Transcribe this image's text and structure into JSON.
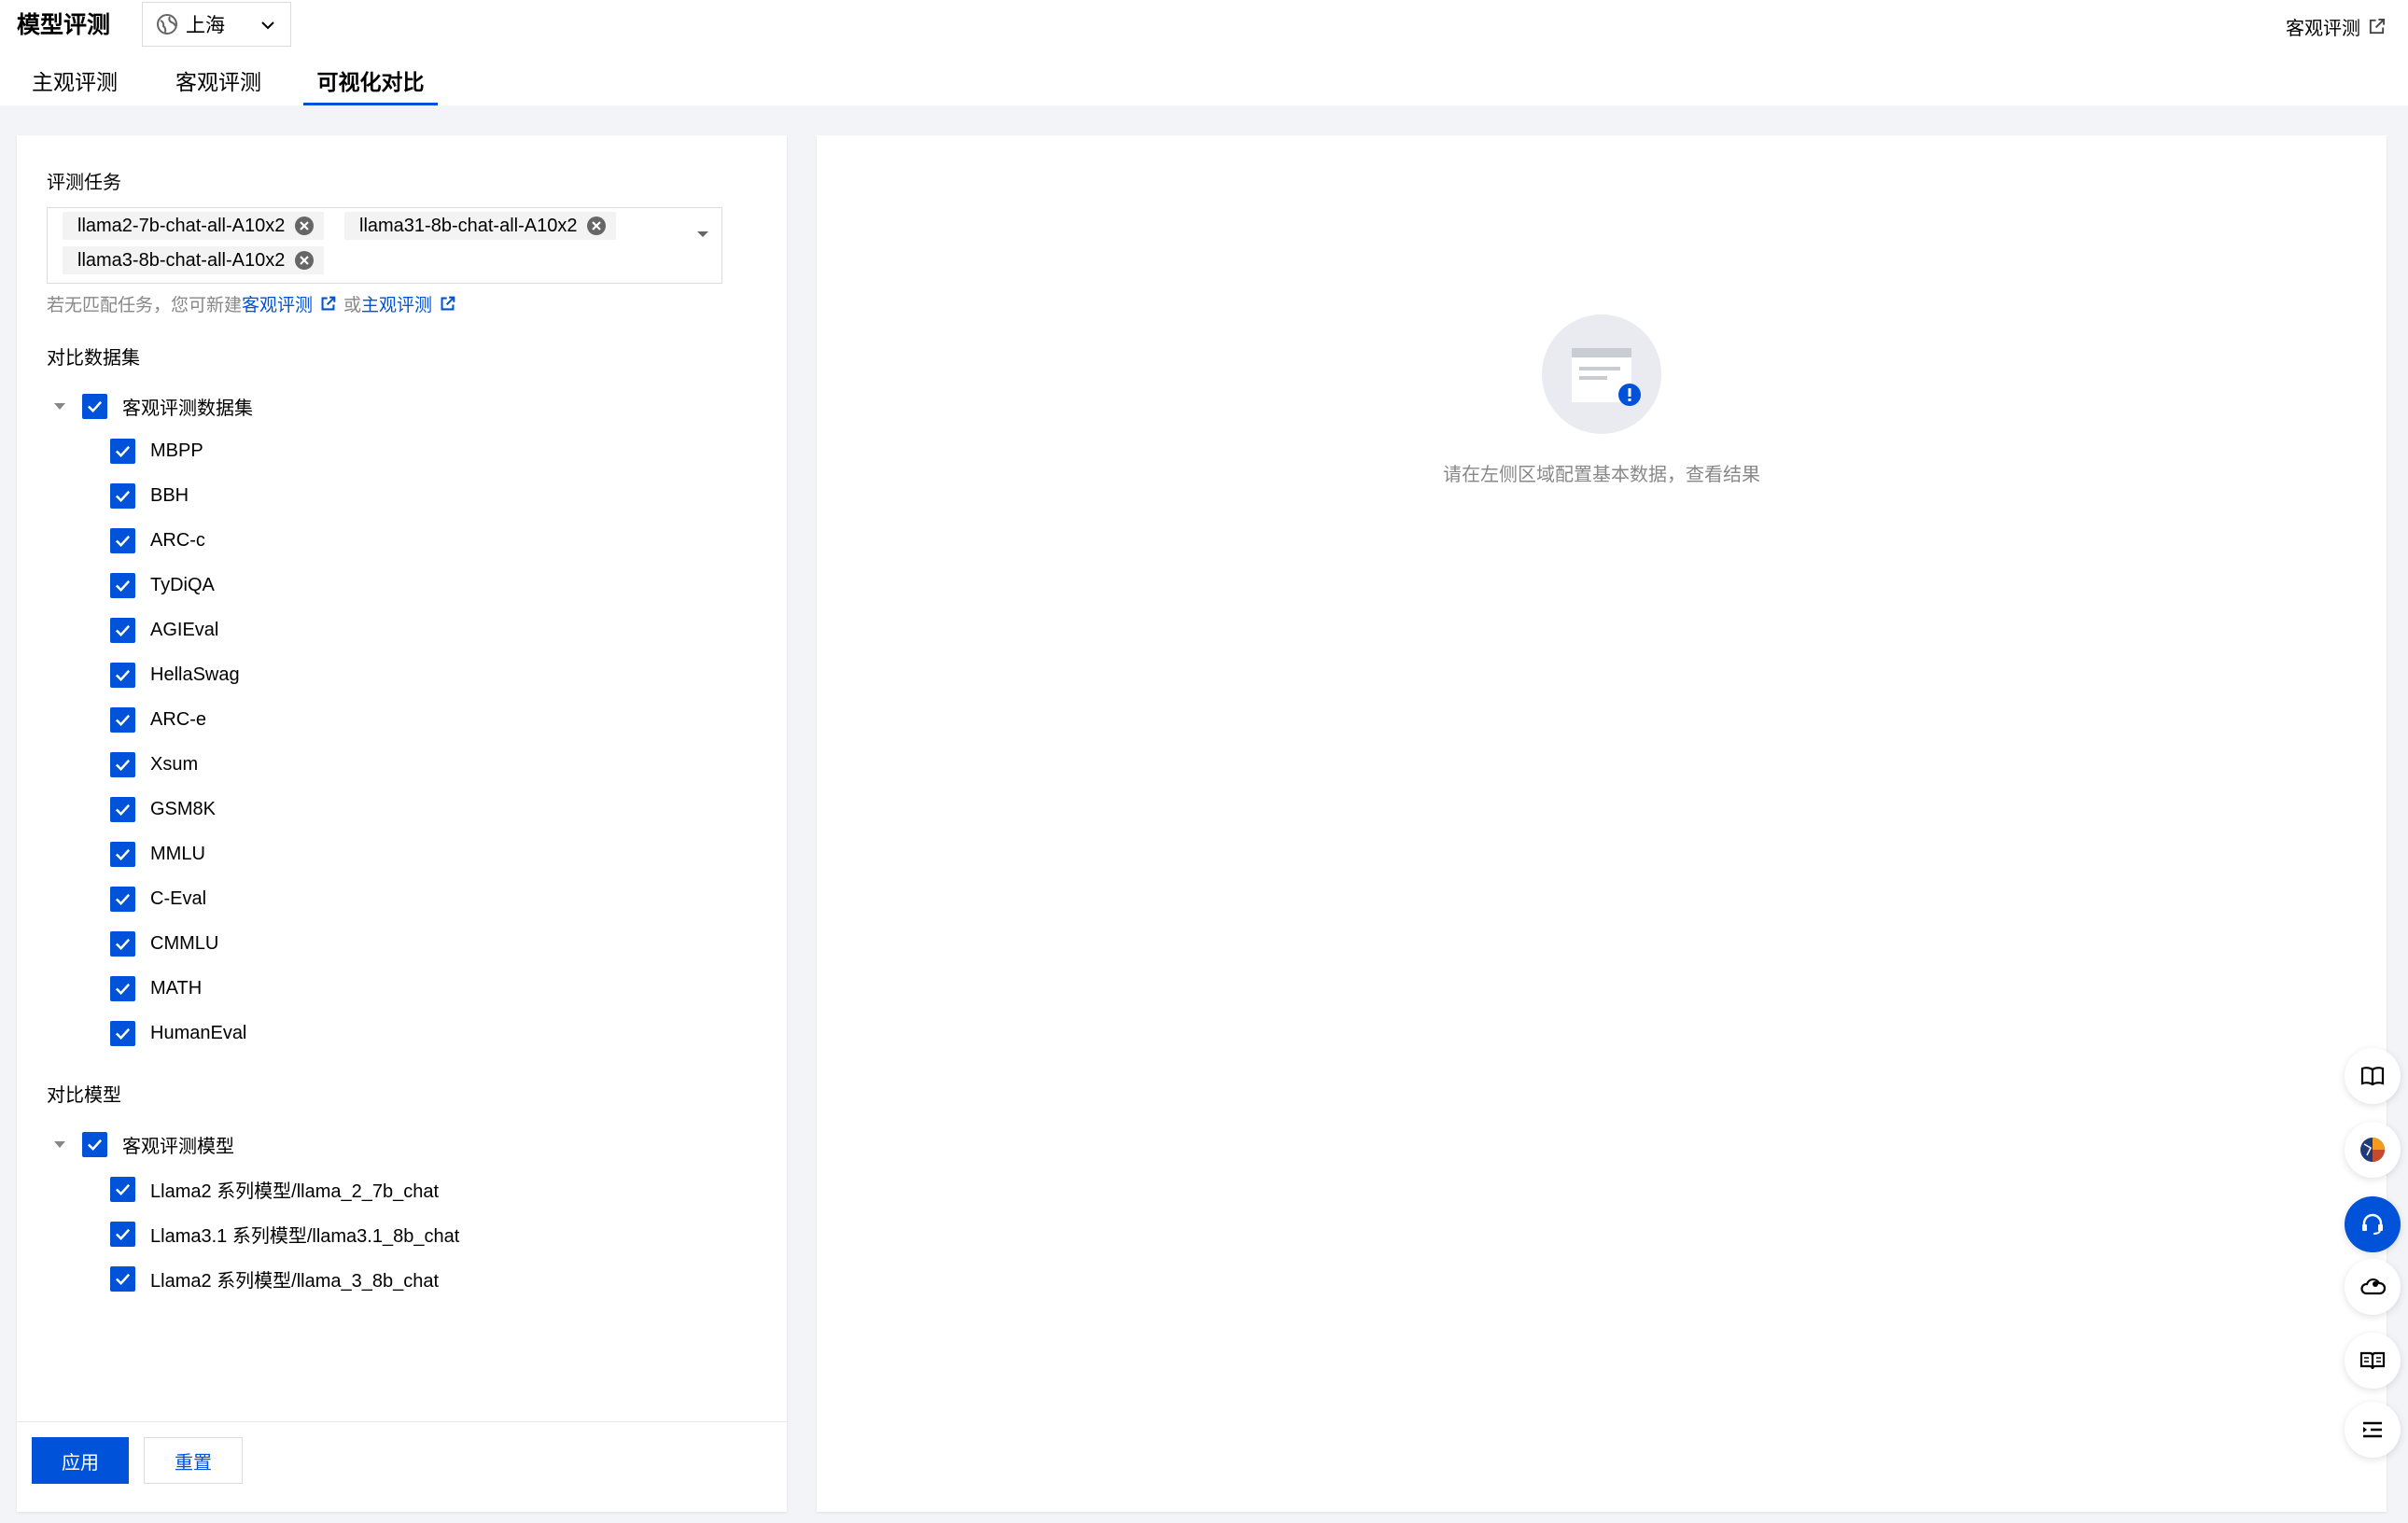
{
  "header": {
    "app_title": "模型评测",
    "region": {
      "icon": "globe-icon",
      "label": "上海"
    },
    "top_link": {
      "label": "客观评测",
      "icon": "external-link-icon"
    }
  },
  "tabs": [
    {
      "label": "主观评测",
      "active": false
    },
    {
      "label": "客观评测",
      "active": false
    },
    {
      "label": "可视化对比",
      "active": true
    }
  ],
  "left_panel": {
    "task_label": "评测任务",
    "selected_tasks": [
      "llama2-7b-chat-all-A10x2",
      "llama31-8b-chat-all-A10x2",
      "llama3-8b-chat-all-A10x2"
    ],
    "hint": {
      "prefix": "若无匹配任务，您可新建",
      "link1": "客观评测",
      "middle": "或",
      "link2": "主观评测"
    },
    "dataset_label": "对比数据集",
    "dataset_group": {
      "label": "客观评测数据集",
      "checked": true,
      "expanded": true,
      "items": [
        "MBPP",
        "BBH",
        "ARC-c",
        "TyDiQA",
        "AGIEval",
        "HellaSwag",
        "ARC-e",
        "Xsum",
        "GSM8K",
        "MMLU",
        "C-Eval",
        "CMMLU",
        "MATH",
        "HumanEval"
      ]
    },
    "model_label": "对比模型",
    "model_group": {
      "label": "客观评测模型",
      "checked": true,
      "expanded": true,
      "items": [
        "Llama2 系列模型/llama_2_7b_chat",
        "Llama3.1 系列模型/llama3.1_8b_chat",
        "Llama2 系列模型/llama_3_8b_chat"
      ]
    },
    "apply_label": "应用",
    "reset_label": "重置"
  },
  "right_panel": {
    "empty_icon": "empty-document-icon",
    "empty_text": "请在左侧区域配置基本数据，查看结果"
  },
  "rail": [
    {
      "icon": "book-open-icon"
    },
    {
      "icon": "app-logo-icon"
    },
    {
      "icon": "headset-icon"
    },
    {
      "icon": "cloud-user-icon"
    },
    {
      "icon": "docs-icon"
    },
    {
      "icon": "list-indent-icon"
    }
  ],
  "colors": {
    "accent": "#0052d9",
    "background": "#f3f4f7",
    "hint_text": "#888888"
  }
}
